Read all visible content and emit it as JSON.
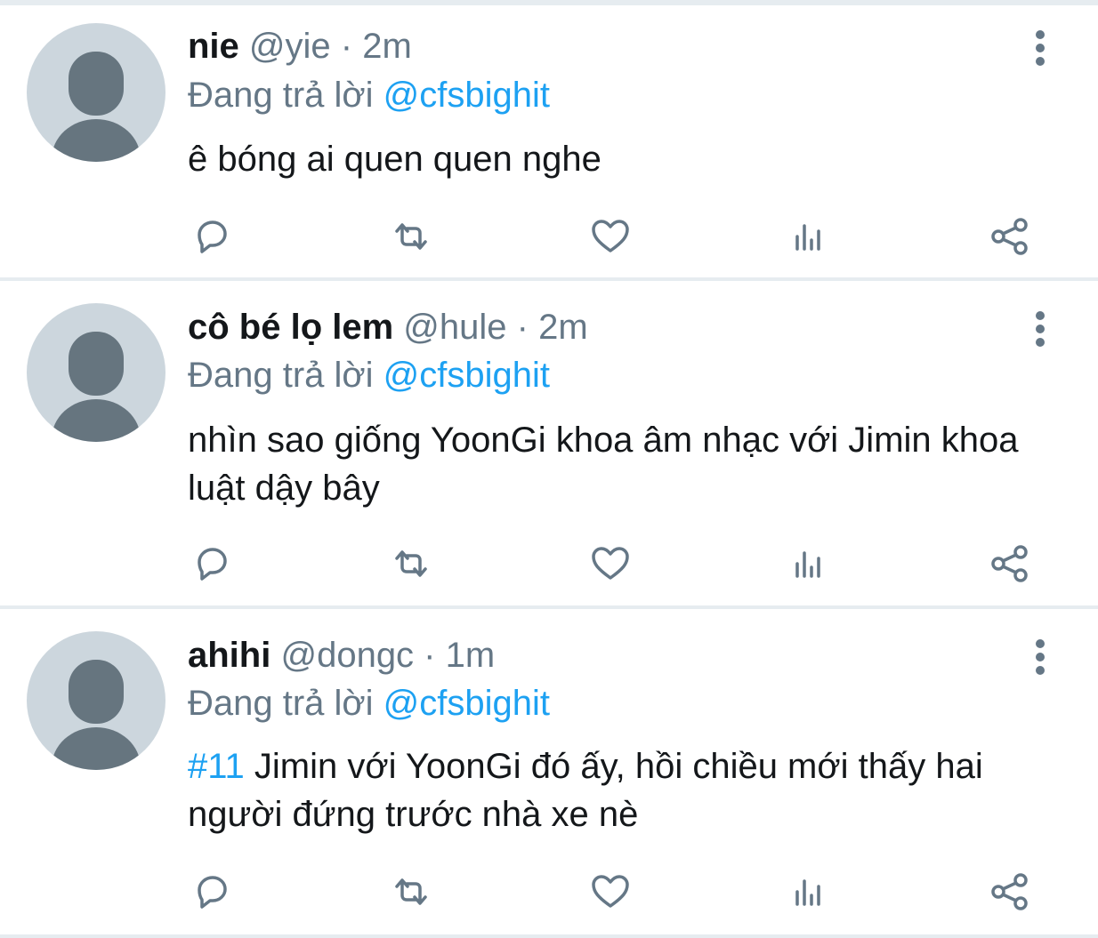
{
  "tweets": [
    {
      "name": "nie",
      "handle": "@yie",
      "sep": " · ",
      "time": "2m",
      "reply_prefix": "Đang trả lời ",
      "reply_to": "@cfsbighit",
      "hashtag": "",
      "text": "ê bóng ai quen quen nghe"
    },
    {
      "name": "cô bé lọ lem",
      "handle": "@hule",
      "sep": " · ",
      "time": "2m",
      "reply_prefix": "Đang trả lời ",
      "reply_to": "@cfsbighit",
      "hashtag": "",
      "text": "nhìn sao giống YoonGi khoa âm nhạc với Jimin khoa luật dậy bây"
    },
    {
      "name": "ahihi",
      "handle": "@dongc",
      "sep": " · ",
      "time": "1m",
      "reply_prefix": "Đang trả lời ",
      "reply_to": "@cfsbighit",
      "hashtag": "#11",
      "text": " Jimin với YoonGi đó ấy, hồi chiều mới thấy hai người đứng trước nhà xe nè"
    }
  ],
  "icons": {
    "reply": "reply-icon",
    "retweet": "retweet-icon",
    "like": "like-icon",
    "analytics": "analytics-icon",
    "share": "share-icon",
    "more": "more-vertical-icon"
  },
  "colors": {
    "accent": "#1da1f2",
    "secondary_text": "#657786",
    "primary_text": "#14171a",
    "avatar_bg": "#ccd6dd",
    "divider": "#e6ecf0"
  }
}
